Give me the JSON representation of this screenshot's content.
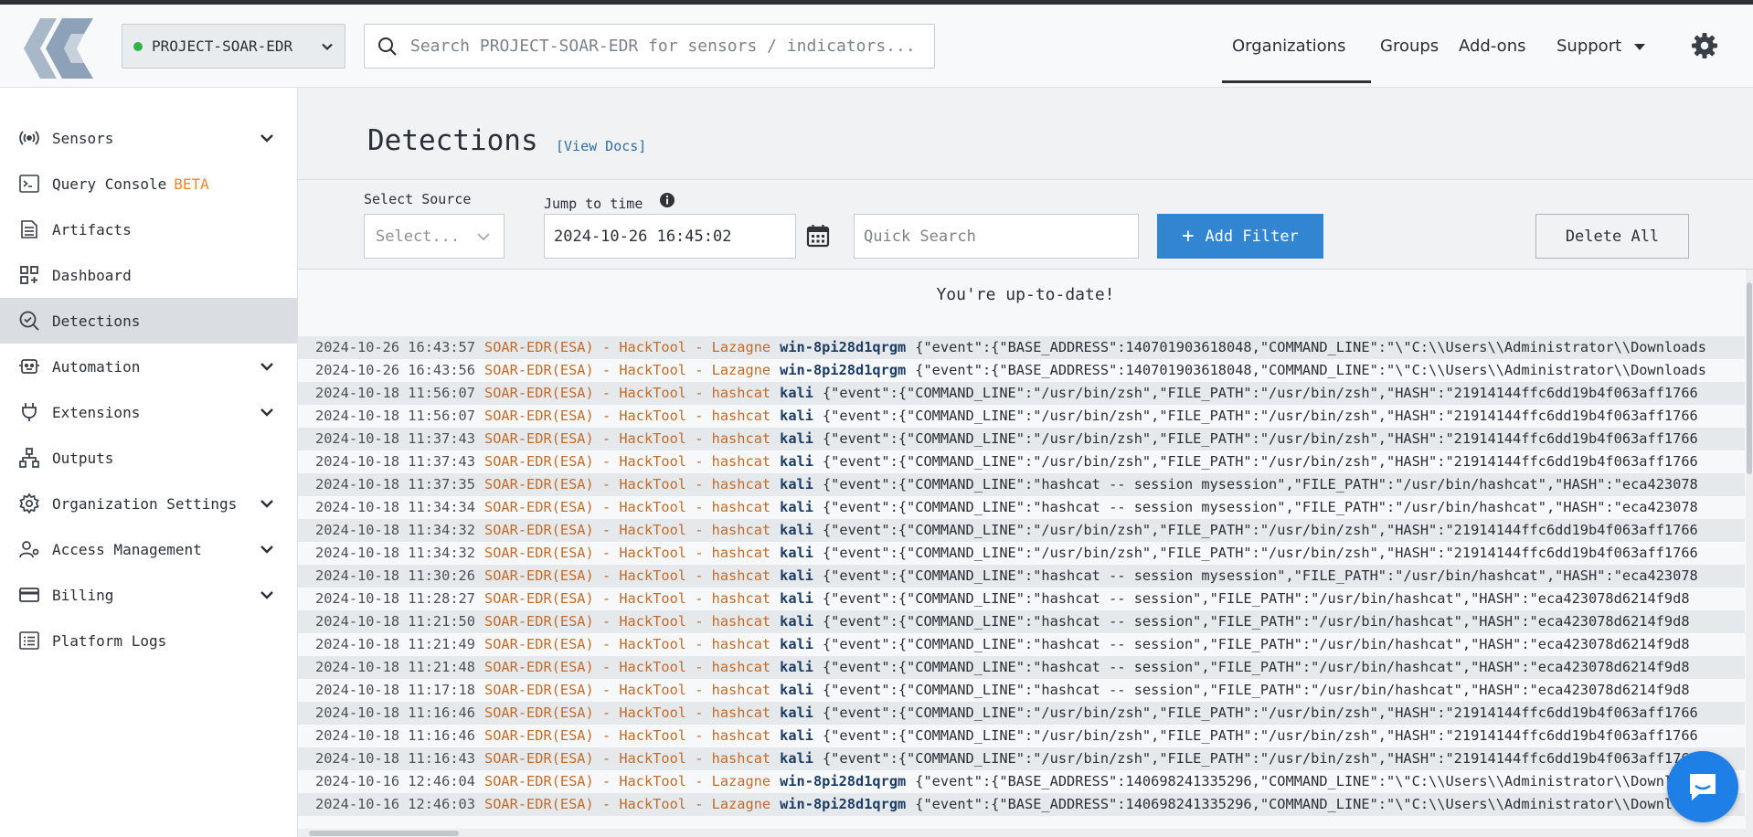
{
  "colors": {
    "accent": "#3185d1",
    "status_online": "#34b24a",
    "category": "#c26b2a",
    "host": "#1b3c63",
    "beta": "#e88a2b"
  },
  "header": {
    "project": "PROJECT-SOAR-EDR",
    "search_placeholder": "Search PROJECT-SOAR-EDR for sensors / indicators...",
    "nav": {
      "organizations": "Organizations",
      "groups": "Groups",
      "addons": "Add-ons",
      "support": "Support"
    }
  },
  "sidebar": {
    "items": [
      {
        "label": "Sensors",
        "icon": "broadcast-icon",
        "expandable": true
      },
      {
        "label": "Query Console",
        "badge": "BETA",
        "icon": "terminal-icon",
        "expandable": false
      },
      {
        "label": "Artifacts",
        "icon": "document-icon",
        "expandable": false
      },
      {
        "label": "Dashboard",
        "icon": "dashboard-grid-icon",
        "expandable": false
      },
      {
        "label": "Detections",
        "icon": "magnify-check-icon",
        "expandable": false,
        "active": true
      },
      {
        "label": "Automation",
        "icon": "robot-icon",
        "expandable": true
      },
      {
        "label": "Extensions",
        "icon": "plug-icon",
        "expandable": true
      },
      {
        "label": "Outputs",
        "icon": "hierarchy-icon",
        "expandable": false
      },
      {
        "label": "Organization Settings",
        "icon": "gear-icon",
        "expandable": true
      },
      {
        "label": "Access Management",
        "icon": "user-gear-icon",
        "expandable": true
      },
      {
        "label": "Billing",
        "icon": "credit-card-icon",
        "expandable": true
      },
      {
        "label": "Platform Logs",
        "icon": "list-icon",
        "expandable": false
      }
    ]
  },
  "main": {
    "title": "Detections",
    "view_docs": "[View Docs]",
    "select_source_label": "Select Source",
    "select_source_placeholder": "Select...",
    "jump_label": "Jump to time",
    "jump_value": "2024-10-26 16:45:02",
    "quick_search_placeholder": "Quick Search",
    "add_filter": "Add Filter",
    "delete_all": "Delete All",
    "up_to_date": "You're up-to-date!"
  },
  "detections": [
    {
      "ts": "2024-10-26 16:43:57",
      "cat": "SOAR-EDR(ESA) - HackTool - Lazagne",
      "host": "win-8pi28d1qrgm",
      "event": "{\"event\":{\"BASE_ADDRESS\":140701903618048,\"COMMAND_LINE\":\"\\\"C:\\\\Users\\\\Administrator\\\\Downloads"
    },
    {
      "ts": "2024-10-26 16:43:56",
      "cat": "SOAR-EDR(ESA) - HackTool - Lazagne",
      "host": "win-8pi28d1qrgm",
      "event": "{\"event\":{\"BASE_ADDRESS\":140701903618048,\"COMMAND_LINE\":\"\\\"C:\\\\Users\\\\Administrator\\\\Downloads"
    },
    {
      "ts": "2024-10-18 11:56:07",
      "cat": "SOAR-EDR(ESA) - HackTool - hashcat",
      "host": "kali",
      "event": "{\"event\":{\"COMMAND_LINE\":\"/usr/bin/zsh\",\"FILE_PATH\":\"/usr/bin/zsh\",\"HASH\":\"21914144ffc6dd19b4f063aff1766"
    },
    {
      "ts": "2024-10-18 11:56:07",
      "cat": "SOAR-EDR(ESA) - HackTool - hashcat",
      "host": "kali",
      "event": "{\"event\":{\"COMMAND_LINE\":\"/usr/bin/zsh\",\"FILE_PATH\":\"/usr/bin/zsh\",\"HASH\":\"21914144ffc6dd19b4f063aff1766"
    },
    {
      "ts": "2024-10-18 11:37:43",
      "cat": "SOAR-EDR(ESA) - HackTool - hashcat",
      "host": "kali",
      "event": "{\"event\":{\"COMMAND_LINE\":\"/usr/bin/zsh\",\"FILE_PATH\":\"/usr/bin/zsh\",\"HASH\":\"21914144ffc6dd19b4f063aff1766"
    },
    {
      "ts": "2024-10-18 11:37:43",
      "cat": "SOAR-EDR(ESA) - HackTool - hashcat",
      "host": "kali",
      "event": "{\"event\":{\"COMMAND_LINE\":\"/usr/bin/zsh\",\"FILE_PATH\":\"/usr/bin/zsh\",\"HASH\":\"21914144ffc6dd19b4f063aff1766"
    },
    {
      "ts": "2024-10-18 11:37:35",
      "cat": "SOAR-EDR(ESA) - HackTool - hashcat",
      "host": "kali",
      "event": "{\"event\":{\"COMMAND_LINE\":\"hashcat -- session mysession\",\"FILE_PATH\":\"/usr/bin/hashcat\",\"HASH\":\"eca423078"
    },
    {
      "ts": "2024-10-18 11:34:34",
      "cat": "SOAR-EDR(ESA) - HackTool - hashcat",
      "host": "kali",
      "event": "{\"event\":{\"COMMAND_LINE\":\"hashcat -- session mysession\",\"FILE_PATH\":\"/usr/bin/hashcat\",\"HASH\":\"eca423078"
    },
    {
      "ts": "2024-10-18 11:34:32",
      "cat": "SOAR-EDR(ESA) - HackTool - hashcat",
      "host": "kali",
      "event": "{\"event\":{\"COMMAND_LINE\":\"/usr/bin/zsh\",\"FILE_PATH\":\"/usr/bin/zsh\",\"HASH\":\"21914144ffc6dd19b4f063aff1766"
    },
    {
      "ts": "2024-10-18 11:34:32",
      "cat": "SOAR-EDR(ESA) - HackTool - hashcat",
      "host": "kali",
      "event": "{\"event\":{\"COMMAND_LINE\":\"/usr/bin/zsh\",\"FILE_PATH\":\"/usr/bin/zsh\",\"HASH\":\"21914144ffc6dd19b4f063aff1766"
    },
    {
      "ts": "2024-10-18 11:30:26",
      "cat": "SOAR-EDR(ESA) - HackTool - hashcat",
      "host": "kali",
      "event": "{\"event\":{\"COMMAND_LINE\":\"hashcat -- session mysession\",\"FILE_PATH\":\"/usr/bin/hashcat\",\"HASH\":\"eca423078"
    },
    {
      "ts": "2024-10-18 11:28:27",
      "cat": "SOAR-EDR(ESA) - HackTool - hashcat",
      "host": "kali",
      "event": "{\"event\":{\"COMMAND_LINE\":\"hashcat -- session\",\"FILE_PATH\":\"/usr/bin/hashcat\",\"HASH\":\"eca423078d6214f9d8"
    },
    {
      "ts": "2024-10-18 11:21:50",
      "cat": "SOAR-EDR(ESA) - HackTool - hashcat",
      "host": "kali",
      "event": "{\"event\":{\"COMMAND_LINE\":\"hashcat -- session\",\"FILE_PATH\":\"/usr/bin/hashcat\",\"HASH\":\"eca423078d6214f9d8"
    },
    {
      "ts": "2024-10-18 11:21:49",
      "cat": "SOAR-EDR(ESA) - HackTool - hashcat",
      "host": "kali",
      "event": "{\"event\":{\"COMMAND_LINE\":\"hashcat -- session\",\"FILE_PATH\":\"/usr/bin/hashcat\",\"HASH\":\"eca423078d6214f9d8"
    },
    {
      "ts": "2024-10-18 11:21:48",
      "cat": "SOAR-EDR(ESA) - HackTool - hashcat",
      "host": "kali",
      "event": "{\"event\":{\"COMMAND_LINE\":\"hashcat -- session\",\"FILE_PATH\":\"/usr/bin/hashcat\",\"HASH\":\"eca423078d6214f9d8"
    },
    {
      "ts": "2024-10-18 11:17:18",
      "cat": "SOAR-EDR(ESA) - HackTool - hashcat",
      "host": "kali",
      "event": "{\"event\":{\"COMMAND_LINE\":\"hashcat -- session\",\"FILE_PATH\":\"/usr/bin/hashcat\",\"HASH\":\"eca423078d6214f9d8"
    },
    {
      "ts": "2024-10-18 11:16:46",
      "cat": "SOAR-EDR(ESA) - HackTool - hashcat",
      "host": "kali",
      "event": "{\"event\":{\"COMMAND_LINE\":\"/usr/bin/zsh\",\"FILE_PATH\":\"/usr/bin/zsh\",\"HASH\":\"21914144ffc6dd19b4f063aff1766"
    },
    {
      "ts": "2024-10-18 11:16:46",
      "cat": "SOAR-EDR(ESA) - HackTool - hashcat",
      "host": "kali",
      "event": "{\"event\":{\"COMMAND_LINE\":\"/usr/bin/zsh\",\"FILE_PATH\":\"/usr/bin/zsh\",\"HASH\":\"21914144ffc6dd19b4f063aff1766"
    },
    {
      "ts": "2024-10-18 11:16:43",
      "cat": "SOAR-EDR(ESA) - HackTool - hashcat",
      "host": "kali",
      "event": "{\"event\":{\"COMMAND_LINE\":\"/usr/bin/zsh\",\"FILE_PATH\":\"/usr/bin/zsh\",\"HASH\":\"21914144ffc6dd19b4f063aff1766"
    },
    {
      "ts": "2024-10-16 12:46:04",
      "cat": "SOAR-EDR(ESA) - HackTool - Lazagne",
      "host": "win-8pi28d1qrgm",
      "event": "{\"event\":{\"BASE_ADDRESS\":140698241335296,\"COMMAND_LINE\":\"\\\"C:\\\\Users\\\\Administrator\\\\Downloads"
    },
    {
      "ts": "2024-10-16 12:46:03",
      "cat": "SOAR-EDR(ESA) - HackTool - Lazagne",
      "host": "win-8pi28d1qrgm",
      "event": "{\"event\":{\"BASE_ADDRESS\":140698241335296,\"COMMAND_LINE\":\"\\\"C:\\\\Users\\\\Administrator\\\\Downloads"
    }
  ]
}
